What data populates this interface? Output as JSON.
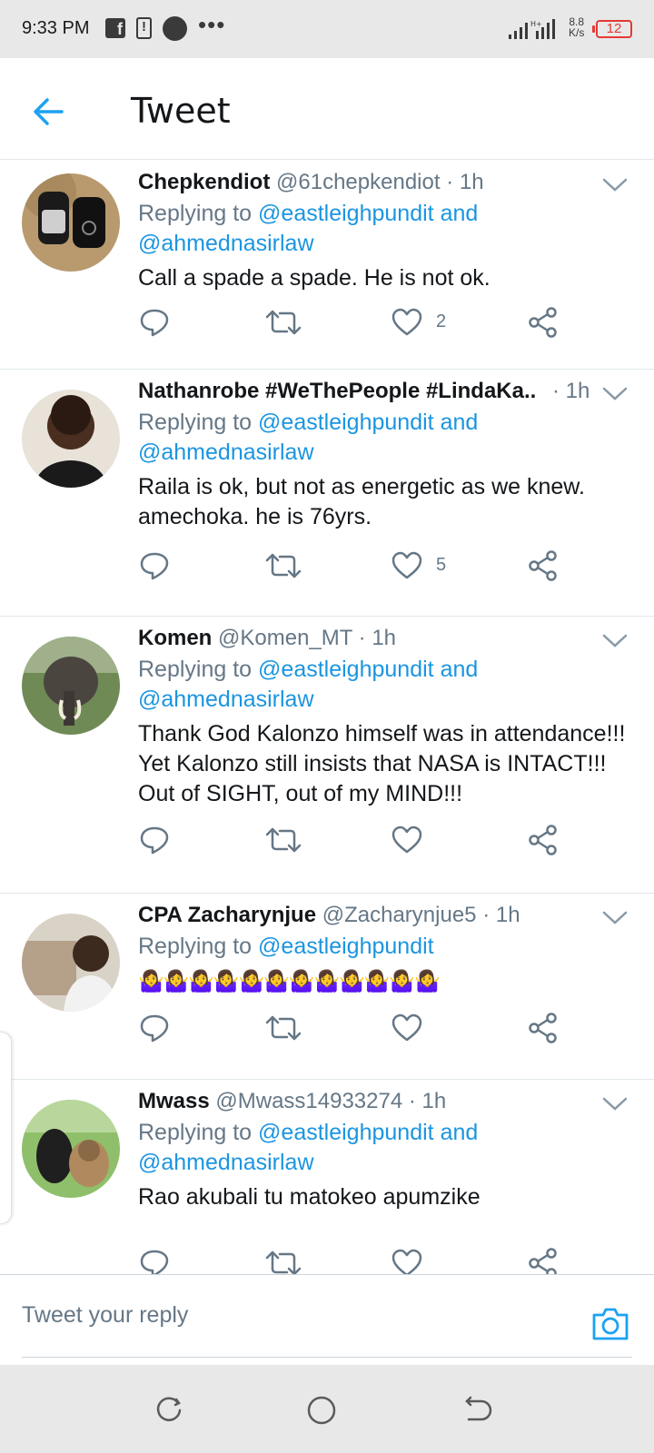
{
  "status_bar": {
    "time": "9:33 PM",
    "speed_value": "8.8",
    "speed_unit": "K/s",
    "battery": "12",
    "icons": [
      "facebook-icon",
      "battery-alert-icon",
      "circle-notification-icon",
      "more-dots-icon",
      "signal-icon",
      "wifi-signal-icon"
    ]
  },
  "header": {
    "title": "Tweet",
    "back_icon": "arrow-left-icon"
  },
  "colors": {
    "link_blue": "#1b95e0",
    "secondary_text": "#657786",
    "primary_text": "#14171a",
    "divider": "#e1e8ed",
    "battery_red": "#e53935"
  },
  "tweets": [
    {
      "name": "Chepkendiot",
      "handle": "@61chepkendiot",
      "time": "· 1h",
      "replying_prefix": "Replying to",
      "mention_1": "@eastleighpundit",
      "and": "and",
      "mention_2": "@ahmednasirlaw",
      "text_1": "Call a spade a spade. He is not ok.",
      "likes": "2"
    },
    {
      "name": "Nathanrobe #WeThePeople #LindaKa...",
      "handle": "",
      "time": "· 1h",
      "replying_prefix": "Replying to",
      "mention_1": "@eastleighpundit",
      "and": "and",
      "mention_2": "@ahmednasirlaw",
      "text_1": "Raila is ok, but not as energetic as we knew.",
      "text_2": "amechoka. he is 76yrs.",
      "likes": "5"
    },
    {
      "name": "Komen",
      "handle": "@Komen_MT",
      "time": "· 1h",
      "replying_prefix": "Replying to",
      "mention_1": "@eastleighpundit",
      "and": "and",
      "mention_2": "@ahmednasirlaw",
      "text_1": "Thank God Kalonzo himself was in attendance!!!",
      "text_2": "Yet Kalonzo still insists that NASA is INTACT!!!",
      "text_3": "Out of SIGHT, out of my MIND!!!",
      "likes": ""
    },
    {
      "name": "CPA Zacharynjue",
      "handle": "@Zacharynjue5",
      "time": "· 1h",
      "replying_prefix": "Replying to",
      "mention_1": "@eastleighpundit",
      "text_1": "🤷‍♀️🤷‍♀️🤷‍♀️🤷‍♀️🤷‍♀️🤷‍♀️🤷‍♀️🤷‍♀️🤷‍♀️🤷‍♀️🤷‍♀️🤷‍♀️",
      "likes": ""
    },
    {
      "name": "Mwass",
      "handle": "@Mwass14933274",
      "time": "· 1h",
      "replying_prefix": "Replying to",
      "mention_1": "@eastleighpundit",
      "and": "and",
      "mention_2": "@ahmednasirlaw",
      "text_1": "Rao akubali tu matokeo apumzike",
      "likes": ""
    }
  ],
  "action_icons": [
    "reply-icon",
    "retweet-icon",
    "like-icon",
    "share-icon"
  ],
  "reply_bar": {
    "placeholder": "Tweet your reply",
    "camera_icon": "camera-icon"
  },
  "nav_bar": {
    "icons": [
      "recent-apps-icon",
      "home-icon",
      "back-icon"
    ]
  }
}
